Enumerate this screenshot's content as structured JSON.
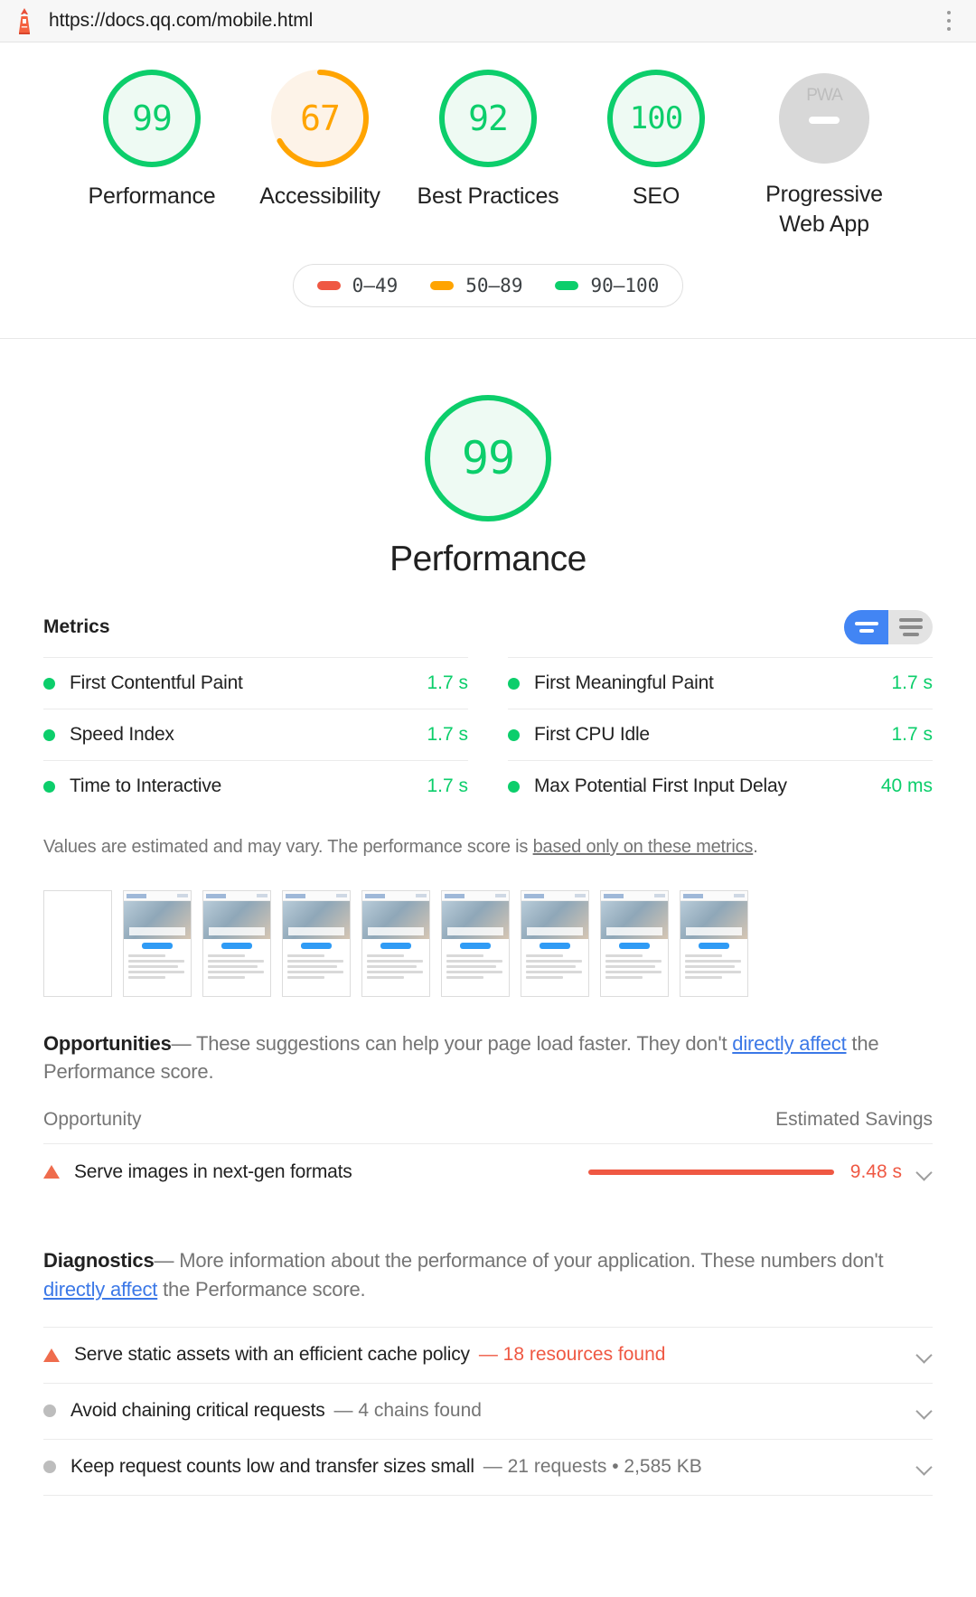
{
  "browser": {
    "url": "https://docs.qq.com/mobile.html",
    "lighthouse_icon": "lighthouse-icon",
    "menu_icon": "kebab-menu-icon"
  },
  "summary": {
    "gauges": [
      {
        "score": "99",
        "label": "Performance",
        "color": "#0cce6b",
        "fill": "#eefaf3"
      },
      {
        "score": "67",
        "label": "Accessibility",
        "color": "#ffa400",
        "fill": "#fdf3e8"
      },
      {
        "score": "92",
        "label": "Best Practices",
        "color": "#0cce6b",
        "fill": "#eefaf3"
      },
      {
        "score": "100",
        "label": "SEO",
        "color": "#0cce6b",
        "fill": "#eefaf3"
      },
      {
        "score": "",
        "label": "Progressive Web App",
        "color": "#d8d8d8",
        "fill": "#d8d8d8",
        "badge": "PWA"
      }
    ],
    "legend": [
      {
        "range": "0–49",
        "color": "#ef5843"
      },
      {
        "range": "50–89",
        "color": "#ffa400"
      },
      {
        "range": "90–100",
        "color": "#0cce6b"
      }
    ]
  },
  "hero": {
    "score": "99",
    "title": "Performance",
    "color": "#0cce6b",
    "fill": "#eefaf3"
  },
  "metrics": {
    "title": "Metrics",
    "toggle": {
      "simple_icon": "simple-view-icon",
      "expanded_icon": "expanded-view-icon",
      "selected": "simple"
    },
    "items": [
      {
        "name": "First Contentful Paint",
        "value": "1.7 s",
        "status": "pass"
      },
      {
        "name": "First Meaningful Paint",
        "value": "1.7 s",
        "status": "pass"
      },
      {
        "name": "Speed Index",
        "value": "1.7 s",
        "status": "pass"
      },
      {
        "name": "First CPU Idle",
        "value": "1.7 s",
        "status": "pass"
      },
      {
        "name": "Time to Interactive",
        "value": "1.7 s",
        "status": "pass"
      },
      {
        "name": "Max Potential First Input Delay",
        "value": "40 ms",
        "status": "pass"
      }
    ],
    "note_before": "Values are estimated and may vary. The performance score is ",
    "note_link": "based only on these metrics",
    "note_after": "."
  },
  "filmstrip": {
    "frame_count": 9,
    "first_blank": true
  },
  "opportunities": {
    "heading": "Opportunities",
    "dash": "—",
    "lead_before": " These suggestions can help your page load faster. They don't ",
    "lead_link": "directly affect",
    "lead_after": " the Performance score.",
    "col_opportunity": "Opportunity",
    "col_savings": "Estimated Savings",
    "rows": [
      {
        "icon": "warning-triangle-icon",
        "name": "Serve images in next-gen formats",
        "savings": "9.48 s",
        "bar_color": "#ef5843",
        "bar_fraction": 1.0,
        "expand_icon": "chevron-down-icon"
      }
    ]
  },
  "diagnostics": {
    "heading": "Diagnostics",
    "dash": "—",
    "lead_before": " More information about the performance of your application. These numbers don't ",
    "lead_link": "directly affect",
    "lead_after": " the Performance score.",
    "rows": [
      {
        "icon": "warning-triangle-icon",
        "name": "Serve static assets with an efficient cache policy",
        "detail": "— 18 resources found",
        "severity": "warn",
        "expand_icon": "chevron-down-icon"
      },
      {
        "icon": "neutral-dot-icon",
        "name": "Avoid chaining critical requests",
        "detail": "— 4 chains found",
        "severity": "info",
        "expand_icon": "chevron-down-icon"
      },
      {
        "icon": "neutral-dot-icon",
        "name": "Keep request counts low and transfer sizes small",
        "detail": "— 21 requests • 2,585 KB",
        "severity": "info",
        "expand_icon": "chevron-down-icon"
      }
    ]
  }
}
